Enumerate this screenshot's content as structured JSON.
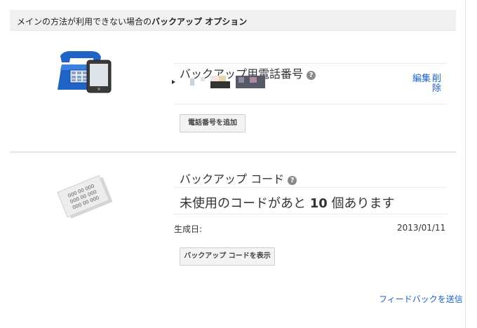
{
  "header": {
    "prefix": "メインの方法が利用できない場合の",
    "bold": "バックアップ オプション"
  },
  "phone_section": {
    "title": "バックアップ用電話番号",
    "help_icon": "help-icon",
    "illustration": "telephone-and-mobile-icon",
    "edit_label": "編集",
    "delete_label": "削除",
    "add_button": "電話番号を追加"
  },
  "codes_section": {
    "title": "バックアップ コード",
    "help_icon": "help-icon",
    "illustration": "backup-code-cards-icon",
    "unused_prefix": "未使用のコードがあと",
    "unused_count": "10",
    "unused_suffix": "個あります",
    "generated_label": "生成日:",
    "generated_date": "2013/01/11",
    "show_button": "バックアップ コードを表示",
    "card_code": "000 00 000"
  },
  "footer": {
    "feedback_link": "フィードバックを送信"
  },
  "colors": {
    "link": "#1a62c7",
    "phone_blue": "#1f63c6",
    "header_bg": "#f1f1f1"
  }
}
